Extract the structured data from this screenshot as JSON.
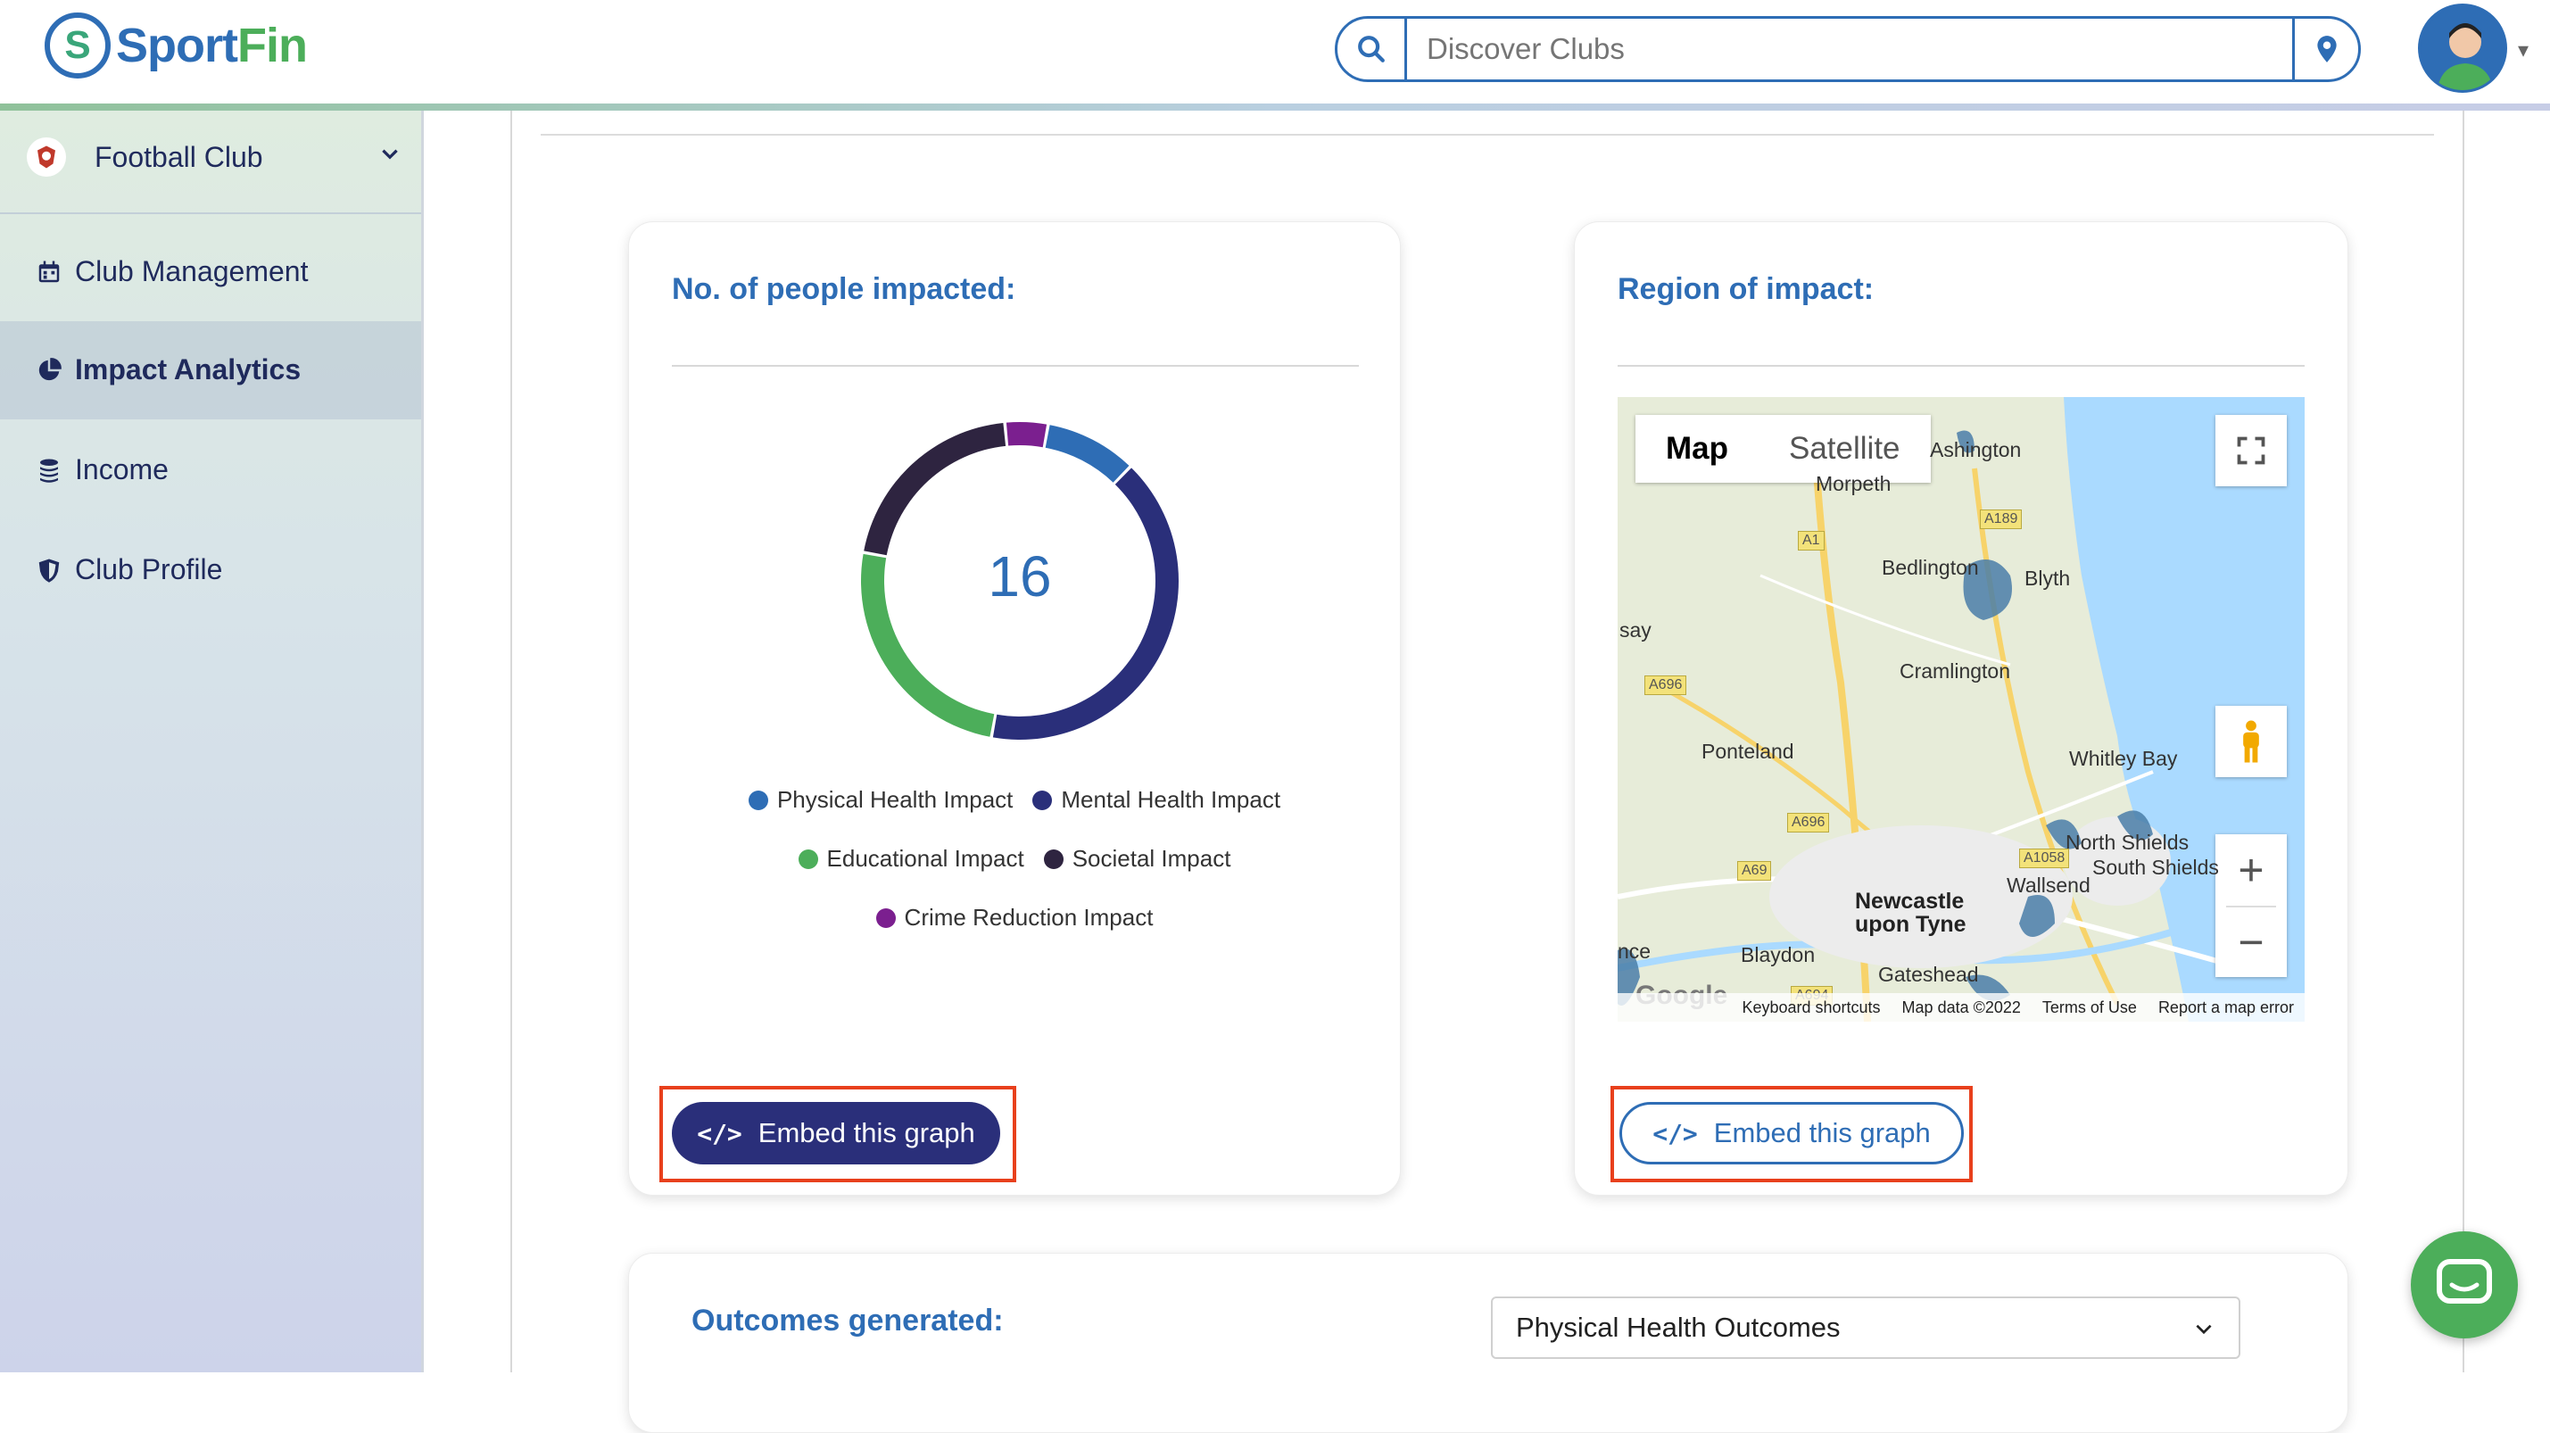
{
  "brand": {
    "name_part1": "Sport",
    "name_part2": "Fin"
  },
  "search": {
    "placeholder": "Discover Clubs"
  },
  "sidebar": {
    "club_name": "Football Club",
    "items": [
      {
        "label": "Club Management",
        "icon": "calendar-icon"
      },
      {
        "label": "Impact Analytics",
        "icon": "pie-chart-icon",
        "active": true
      },
      {
        "label": "Income",
        "icon": "coins-icon"
      },
      {
        "label": "Club Profile",
        "icon": "shield-icon"
      }
    ]
  },
  "people_card": {
    "title": "No. of people impacted:",
    "total": "16",
    "embed_label": "Embed this graph"
  },
  "chart_data": {
    "type": "pie",
    "categories": [
      "Physical Health Impact",
      "Mental Health Impact",
      "Educational Impact",
      "Societal Impact",
      "Crime Reduction Impact"
    ],
    "values": [
      1.5,
      6.5,
      4,
      3.3,
      0.7
    ],
    "colors": [
      "#2e6db5",
      "#2a2f7a",
      "#4cae5a",
      "#2e2440",
      "#7b1f8f"
    ],
    "center_label": "16",
    "legend": "bottom"
  },
  "region_card": {
    "title": "Region of impact:",
    "embed_label": "Embed this graph",
    "map": {
      "toggle_map": "Map",
      "toggle_satellite": "Satellite",
      "labels": [
        "Ashington",
        "Morpeth",
        "Bedlington",
        "Blyth",
        "Cramlington",
        "Ponteland",
        "Whitley Bay",
        "North Shields",
        "South Shields",
        "Wallsend",
        "Newcastle upon Tyne",
        "Blaydon",
        "Gateshead",
        "say",
        "nce"
      ],
      "roads": [
        "A1",
        "A189",
        "A696",
        "A696",
        "A69",
        "A1058",
        "A694"
      ],
      "footer": [
        "Keyboard shortcuts",
        "Map data ©2022",
        "Terms of Use",
        "Report a map error"
      ],
      "google": "Google"
    }
  },
  "outcomes": {
    "title": "Outcomes generated:",
    "selected": "Physical Health Outcomes"
  }
}
